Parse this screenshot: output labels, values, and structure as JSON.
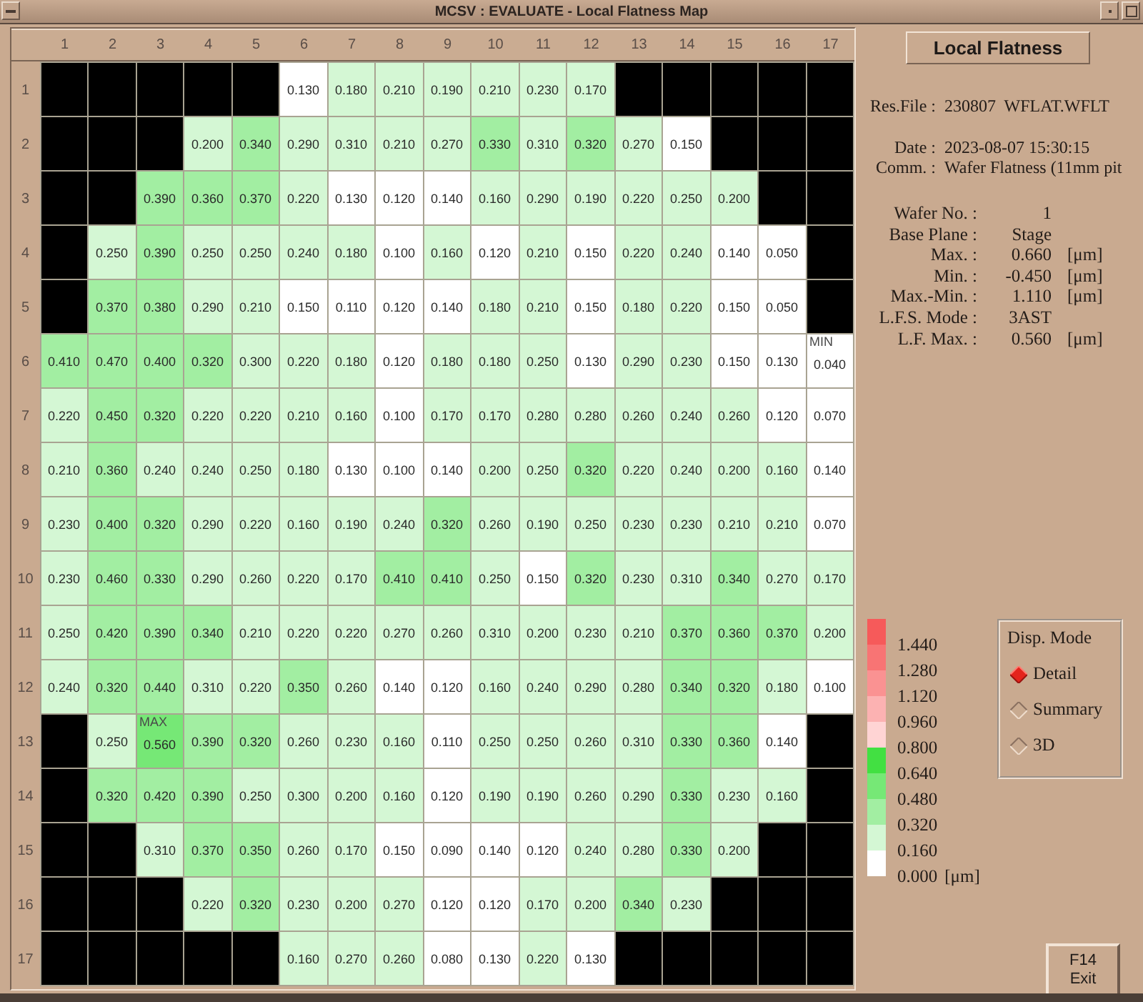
{
  "window": {
    "title": "MCSV : EVALUATE - Local Flatness Map"
  },
  "map": {
    "columns": [
      "1",
      "2",
      "3",
      "4",
      "5",
      "6",
      "7",
      "8",
      "9",
      "10",
      "11",
      "12",
      "13",
      "14",
      "15",
      "16",
      "17"
    ],
    "rows": [
      {
        "label": "1",
        "cells": [
          null,
          null,
          null,
          null,
          null,
          "0.130",
          "0.180",
          "0.210",
          "0.190",
          "0.210",
          "0.230",
          "0.170",
          null,
          null,
          null,
          null,
          null
        ]
      },
      {
        "label": "2",
        "cells": [
          null,
          null,
          null,
          "0.200",
          "0.340",
          "0.290",
          "0.310",
          "0.210",
          "0.270",
          "0.330",
          "0.310",
          "0.320",
          "0.270",
          "0.150",
          null,
          null,
          null
        ]
      },
      {
        "label": "3",
        "cells": [
          null,
          null,
          "0.390",
          "0.360",
          "0.370",
          "0.220",
          "0.130",
          "0.120",
          "0.140",
          "0.160",
          "0.290",
          "0.190",
          "0.220",
          "0.250",
          "0.200",
          null,
          null
        ]
      },
      {
        "label": "4",
        "cells": [
          null,
          "0.250",
          "0.390",
          "0.250",
          "0.250",
          "0.240",
          "0.180",
          "0.100",
          "0.160",
          "0.120",
          "0.210",
          "0.150",
          "0.220",
          "0.240",
          "0.140",
          "0.050",
          null
        ]
      },
      {
        "label": "5",
        "cells": [
          null,
          "0.370",
          "0.380",
          "0.290",
          "0.210",
          "0.150",
          "0.110",
          "0.120",
          "0.140",
          "0.180",
          "0.210",
          "0.150",
          "0.180",
          "0.220",
          "0.150",
          "0.050",
          null
        ]
      },
      {
        "label": "6",
        "cells": [
          "0.410",
          "0.470",
          "0.400",
          "0.320",
          "0.300",
          "0.220",
          "0.180",
          "0.120",
          "0.180",
          "0.180",
          "0.250",
          "0.130",
          "0.290",
          "0.230",
          "0.150",
          "0.130",
          {
            "value": "0.040",
            "tag": "MIN"
          }
        ]
      },
      {
        "label": "7",
        "cells": [
          "0.220",
          "0.450",
          "0.320",
          "0.220",
          "0.220",
          "0.210",
          "0.160",
          "0.100",
          "0.170",
          "0.170",
          "0.280",
          "0.280",
          "0.260",
          "0.240",
          "0.260",
          "0.120",
          "0.070"
        ]
      },
      {
        "label": "8",
        "cells": [
          "0.210",
          "0.360",
          "0.240",
          "0.240",
          "0.250",
          "0.180",
          "0.130",
          "0.100",
          "0.140",
          "0.200",
          "0.250",
          "0.320",
          "0.220",
          "0.240",
          "0.200",
          "0.160",
          "0.140"
        ]
      },
      {
        "label": "9",
        "cells": [
          "0.230",
          "0.400",
          "0.320",
          "0.290",
          "0.220",
          "0.160",
          "0.190",
          "0.240",
          "0.320",
          "0.260",
          "0.190",
          "0.250",
          "0.230",
          "0.230",
          "0.210",
          "0.210",
          "0.070"
        ]
      },
      {
        "label": "10",
        "cells": [
          "0.230",
          "0.460",
          "0.330",
          "0.290",
          "0.260",
          "0.220",
          "0.170",
          "0.410",
          "0.410",
          "0.250",
          "0.150",
          "0.320",
          "0.230",
          "0.310",
          "0.340",
          "0.270",
          "0.170"
        ]
      },
      {
        "label": "11",
        "cells": [
          "0.250",
          "0.420",
          "0.390",
          "0.340",
          "0.210",
          "0.220",
          "0.220",
          "0.270",
          "0.260",
          "0.310",
          "0.200",
          "0.230",
          "0.210",
          "0.370",
          "0.360",
          "0.370",
          "0.200"
        ]
      },
      {
        "label": "12",
        "cells": [
          "0.240",
          "0.320",
          "0.440",
          "0.310",
          "0.220",
          "0.350",
          "0.260",
          "0.140",
          "0.120",
          "0.160",
          "0.240",
          "0.290",
          "0.280",
          "0.340",
          "0.320",
          "0.180",
          "0.100"
        ]
      },
      {
        "label": "13",
        "cells": [
          null,
          "0.250",
          {
            "value": "0.560",
            "tag": "MAX"
          },
          "0.390",
          "0.320",
          "0.260",
          "0.230",
          "0.160",
          "0.110",
          "0.250",
          "0.250",
          "0.260",
          "0.310",
          "0.330",
          "0.360",
          "0.140",
          null
        ]
      },
      {
        "label": "14",
        "cells": [
          null,
          "0.320",
          "0.420",
          "0.390",
          "0.250",
          "0.300",
          "0.200",
          "0.160",
          "0.120",
          "0.190",
          "0.190",
          "0.260",
          "0.290",
          "0.330",
          "0.230",
          "0.160",
          null
        ]
      },
      {
        "label": "15",
        "cells": [
          null,
          null,
          "0.310",
          "0.370",
          "0.350",
          "0.260",
          "0.170",
          "0.150",
          "0.090",
          "0.140",
          "0.120",
          "0.240",
          "0.280",
          "0.330",
          "0.200",
          null,
          null
        ]
      },
      {
        "label": "16",
        "cells": [
          null,
          null,
          null,
          "0.220",
          "0.320",
          "0.230",
          "0.200",
          "0.270",
          "0.120",
          "0.120",
          "0.170",
          "0.200",
          "0.340",
          "0.230",
          null,
          null,
          null
        ]
      },
      {
        "label": "17",
        "cells": [
          null,
          null,
          null,
          null,
          null,
          "0.160",
          "0.270",
          "0.260",
          "0.080",
          "0.130",
          "0.220",
          "0.130",
          null,
          null,
          null,
          null,
          null
        ]
      }
    ]
  },
  "panel": {
    "title": "Local Flatness",
    "file_info": [
      [
        {
          "label": "Res.File :",
          "value": "230807  WFLAT.WFLT"
        }
      ],
      [
        {
          "label": "Date :",
          "value": "2023-08-07 15:30:15"
        },
        {
          "label": "Comm. :",
          "value": "Wafer Flatness (11mm pit"
        }
      ]
    ],
    "stats": [
      {
        "label": "Wafer No. :",
        "value": "1"
      },
      {
        "label": "Base Plane :",
        "value": "Stage"
      },
      {
        "label": "Max. :",
        "value": "0.660",
        "unit": "[μm]"
      },
      {
        "label": "Min. :",
        "value": "-0.450",
        "unit": "[μm]"
      },
      {
        "label": "Max.-Min. :",
        "value": "1.110",
        "unit": "[μm]"
      },
      {
        "label": "L.F.S. Mode :",
        "value": "3AST"
      },
      {
        "label": "L.F. Max. :",
        "value": "0.560",
        "unit": "[μm]"
      }
    ]
  },
  "legend": {
    "items": [
      {
        "label": "1.440",
        "color": "#f65a5a"
      },
      {
        "label": "1.280",
        "color": "#f87474"
      },
      {
        "label": "1.120",
        "color": "#fa9292"
      },
      {
        "label": "0.960",
        "color": "#fcb2b2"
      },
      {
        "label": "0.800",
        "color": "#ffd4d4"
      },
      {
        "label": "0.640",
        "color": "#42e042"
      },
      {
        "label": "0.480",
        "color": "#76e876"
      },
      {
        "label": "0.320",
        "color": "#a2eea2"
      },
      {
        "label": "0.160",
        "color": "#d4f7d4"
      },
      {
        "label": "0.000",
        "color": "#ffffff"
      }
    ],
    "unit": "[μm]"
  },
  "disp_mode": {
    "title": "Disp. Mode",
    "options": [
      {
        "label": "Detail",
        "selected": true
      },
      {
        "label": "Summary",
        "selected": false
      },
      {
        "label": "3D",
        "selected": false
      }
    ]
  },
  "exit_button": {
    "key": "F14",
    "label": "Exit"
  }
}
